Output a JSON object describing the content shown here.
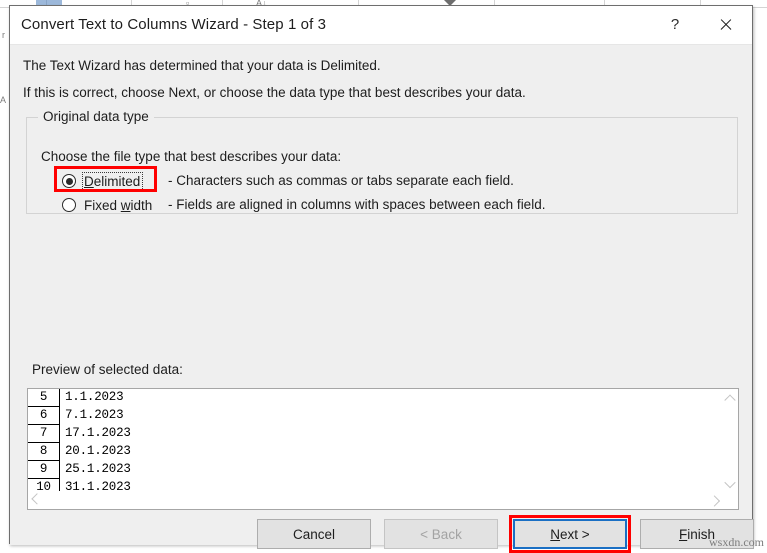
{
  "backdrop": {
    "glyphs": [
      {
        "name": "excel-cell-glyph-a",
        "text": "▫"
      },
      {
        "name": "excel-cell-glyph-b",
        "text": "A↓"
      }
    ]
  },
  "dialog": {
    "title": "Convert Text to Columns Wizard - Step 1 of 3",
    "help_icon": "?",
    "close_icon": "close-x",
    "intro_line_1": "The Text Wizard has determined that your data is Delimited.",
    "intro_line_2": "If this is correct, choose Next, or choose the data type that best describes your data.",
    "group": {
      "legend": "Original data type",
      "instruction": "Choose the file type that best describes your data:",
      "options": [
        {
          "label_pre": "D",
          "label_acc": "",
          "label": "Delimited",
          "accel": "D",
          "description": "- Characters such as commas or tabs separate each field.",
          "selected": true,
          "focused": true
        },
        {
          "label": "Fixed width",
          "accel": "w",
          "description": "- Fields are aligned in columns with spaces between each field.",
          "selected": false,
          "focused": false
        }
      ]
    },
    "preview": {
      "label": "Preview of selected data:",
      "rows": [
        {
          "number": "5",
          "value": "1.1.2023"
        },
        {
          "number": "6",
          "value": "7.1.2023"
        },
        {
          "number": "7",
          "value": "17.1.2023"
        },
        {
          "number": "8",
          "value": "20.1.2023"
        },
        {
          "number": "9",
          "value": "25.1.2023"
        },
        {
          "number": "10",
          "value": "31.1.2023"
        }
      ],
      "scroll_up_icon": "chevron-up-icon",
      "scroll_down_icon": "chevron-down-icon",
      "scroll_left_icon": "chevron-left-icon",
      "scroll_right_icon": "chevron-right-icon"
    },
    "buttons": {
      "cancel": "Cancel",
      "back": "< Back",
      "next": "Next >",
      "next_accel": "N",
      "finish": "Finish",
      "finish_accel": "F",
      "back_disabled": true,
      "next_is_default": true
    },
    "annotations": {
      "highlight_color": "#ff0000",
      "default_button_color": "#1a6fc4"
    }
  },
  "watermark": "wsxdn.com"
}
